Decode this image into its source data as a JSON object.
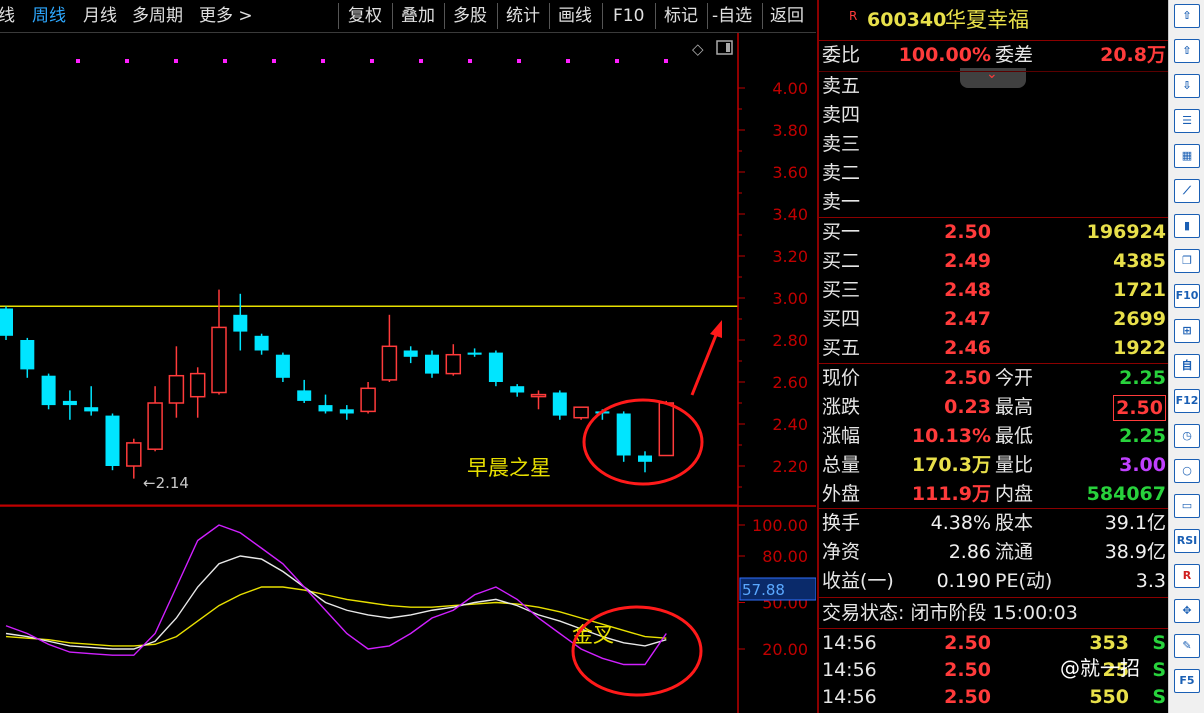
{
  "toolbar": {
    "items": [
      "线",
      "周线",
      "月线",
      "多周期",
      "更多 >",
      "复权",
      "叠加",
      "多股",
      "统计",
      "画线",
      "F10",
      "标记",
      "-自选",
      "返回"
    ]
  },
  "chart": {
    "price_axis": [
      "4.00",
      "3.80",
      "3.60",
      "3.40",
      "3.20",
      "3.00",
      "2.80",
      "2.60",
      "2.40",
      "2.20"
    ],
    "low_label": "←2.14",
    "annotation_star": "早晨之星",
    "indicator_axis": [
      "100.00",
      "80.00",
      "50.00",
      "20.00"
    ],
    "indicator_current": "57.88",
    "annotation_cross": "金叉",
    "colors": {
      "up": "#ff3b3b",
      "down": "#00e5ff",
      "line_yellow": "#e8e000",
      "line_white": "#e8e8e8",
      "line_purple": "#d020ff",
      "axis": "#c00000"
    }
  },
  "chart_data": {
    "type": "candlestick",
    "ylim": [
      2.1,
      4.1
    ],
    "candles": [
      {
        "o": 2.95,
        "h": 2.96,
        "l": 2.8,
        "c": 2.82
      },
      {
        "o": 2.8,
        "h": 2.81,
        "l": 2.62,
        "c": 2.66
      },
      {
        "o": 2.63,
        "h": 2.64,
        "l": 2.47,
        "c": 2.49
      },
      {
        "o": 2.51,
        "h": 2.56,
        "l": 2.42,
        "c": 2.49
      },
      {
        "o": 2.48,
        "h": 2.58,
        "l": 2.44,
        "c": 2.46
      },
      {
        "o": 2.44,
        "h": 2.45,
        "l": 2.18,
        "c": 2.2
      },
      {
        "o": 2.2,
        "h": 2.33,
        "l": 2.14,
        "c": 2.31
      },
      {
        "o": 2.28,
        "h": 2.58,
        "l": 2.27,
        "c": 2.5
      },
      {
        "o": 2.5,
        "h": 2.77,
        "l": 2.43,
        "c": 2.63
      },
      {
        "o": 2.53,
        "h": 2.67,
        "l": 2.43,
        "c": 2.64
      },
      {
        "o": 2.55,
        "h": 3.04,
        "l": 2.54,
        "c": 2.86
      },
      {
        "o": 2.92,
        "h": 3.02,
        "l": 2.75,
        "c": 2.84
      },
      {
        "o": 2.82,
        "h": 2.83,
        "l": 2.73,
        "c": 2.75
      },
      {
        "o": 2.73,
        "h": 2.74,
        "l": 2.6,
        "c": 2.62
      },
      {
        "o": 2.56,
        "h": 2.61,
        "l": 2.5,
        "c": 2.51
      },
      {
        "o": 2.49,
        "h": 2.54,
        "l": 2.45,
        "c": 2.46
      },
      {
        "o": 2.47,
        "h": 2.49,
        "l": 2.42,
        "c": 2.45
      },
      {
        "o": 2.46,
        "h": 2.6,
        "l": 2.45,
        "c": 2.57
      },
      {
        "o": 2.61,
        "h": 2.92,
        "l": 2.6,
        "c": 2.77
      },
      {
        "o": 2.75,
        "h": 2.77,
        "l": 2.69,
        "c": 2.72
      },
      {
        "o": 2.73,
        "h": 2.75,
        "l": 2.62,
        "c": 2.64
      },
      {
        "o": 2.64,
        "h": 2.78,
        "l": 2.63,
        "c": 2.73
      },
      {
        "o": 2.74,
        "h": 2.76,
        "l": 2.72,
        "c": 2.73
      },
      {
        "o": 2.74,
        "h": 2.75,
        "l": 2.58,
        "c": 2.6
      },
      {
        "o": 2.58,
        "h": 2.59,
        "l": 2.53,
        "c": 2.55
      },
      {
        "o": 2.54,
        "h": 2.56,
        "l": 2.47,
        "c": 2.54
      },
      {
        "o": 2.55,
        "h": 2.56,
        "l": 2.42,
        "c": 2.44
      },
      {
        "o": 2.43,
        "h": 2.48,
        "l": 2.42,
        "c": 2.48
      },
      {
        "o": 2.46,
        "h": 2.47,
        "l": 2.42,
        "c": 2.45
      },
      {
        "o": 2.45,
        "h": 2.46,
        "l": 2.22,
        "c": 2.25
      },
      {
        "o": 2.25,
        "h": 2.27,
        "l": 2.17,
        "c": 2.22
      },
      {
        "o": 2.25,
        "h": 2.51,
        "l": 2.25,
        "c": 2.5
      }
    ],
    "resistance": 2.97,
    "indicator_ylim": [
      0,
      110
    ],
    "K": [
      30,
      28,
      25,
      22,
      21,
      20,
      20,
      25,
      40,
      60,
      75,
      80,
      78,
      70,
      60,
      50,
      45,
      42,
      40,
      42,
      45,
      47,
      50,
      52,
      48,
      42,
      38,
      33,
      28,
      24,
      22,
      26
    ],
    "D": [
      28,
      27,
      26,
      24,
      23,
      22,
      22,
      23,
      28,
      38,
      48,
      55,
      60,
      60,
      58,
      55,
      52,
      50,
      48,
      47,
      47,
      48,
      49,
      50,
      49,
      47,
      44,
      40,
      36,
      32,
      28,
      27
    ],
    "J": [
      35,
      30,
      23,
      18,
      17,
      16,
      16,
      30,
      60,
      90,
      100,
      95,
      85,
      75,
      60,
      45,
      30,
      20,
      22,
      30,
      40,
      45,
      55,
      60,
      52,
      40,
      30,
      20,
      14,
      10,
      10,
      30
    ]
  },
  "quote": {
    "code": "600340",
    "name": "华夏幸福",
    "weibi_label": "委比",
    "weibi": "100.00%",
    "weicha_label": "委差",
    "weicha": "20.8万",
    "sell": [
      {
        "label": "卖五"
      },
      {
        "label": "卖四"
      },
      {
        "label": "卖三"
      },
      {
        "label": "卖二"
      },
      {
        "label": "卖一"
      }
    ],
    "buy": [
      {
        "label": "买一",
        "price": "2.50",
        "vol": "196924"
      },
      {
        "label": "买二",
        "price": "2.49",
        "vol": "4385"
      },
      {
        "label": "买三",
        "price": "2.48",
        "vol": "1721"
      },
      {
        "label": "买四",
        "price": "2.47",
        "vol": "2699"
      },
      {
        "label": "买五",
        "price": "2.46",
        "vol": "1922"
      }
    ],
    "stats": [
      {
        "l1": "现价",
        "v1": "2.50",
        "c1": "red",
        "l2": "今开",
        "v2": "2.25",
        "c2": "green"
      },
      {
        "l1": "涨跌",
        "v1": "0.23",
        "c1": "red",
        "l2": "最高",
        "v2": "2.50",
        "c2": "red"
      },
      {
        "l1": "涨幅",
        "v1": "10.13%",
        "c1": "red",
        "l2": "最低",
        "v2": "2.25",
        "c2": "green"
      },
      {
        "l1": "总量",
        "v1": "170.3万",
        "c1": "yellow",
        "l2": "量比",
        "v2": "3.00",
        "c2": "purple"
      },
      {
        "l1": "外盘",
        "v1": "111.9万",
        "c1": "red",
        "l2": "内盘",
        "v2": "584067",
        "c2": "green"
      }
    ],
    "stats2": [
      {
        "l1": "换手",
        "v1": "4.38%",
        "l2": "股本",
        "v2": "39.1亿"
      },
      {
        "l1": "净资",
        "v1": "2.86",
        "l2": "流通",
        "v2": "38.9亿"
      },
      {
        "l1": "收益(一)",
        "v1": "0.190",
        "l2": "PE(动)",
        "v2": "3.3"
      }
    ],
    "status": "交易状态: 闭市阶段 15:00:03",
    "ticks": [
      {
        "time": "14:56",
        "price": "2.50",
        "vol": "353",
        "side": "S"
      },
      {
        "time": "14:56",
        "price": "2.50",
        "vol": "25",
        "side": "S"
      },
      {
        "time": "14:56",
        "price": "2.50",
        "vol": "550",
        "side": "S"
      }
    ]
  },
  "sidebar": {
    "icons": [
      "arrow-up-icon",
      "arrow-up-outline-icon",
      "arrow-down-outline-icon",
      "list-icon",
      "table-icon",
      "line-chart-icon",
      "candle-chart-icon",
      "windows-icon",
      "F10",
      "tree-icon",
      "自",
      "F12",
      "clock-icon",
      "circle-icon",
      "window-icon",
      "RSI",
      "R-icon",
      "move-icon",
      "pencil-icon",
      "F5"
    ]
  },
  "watermark": "@就一招"
}
